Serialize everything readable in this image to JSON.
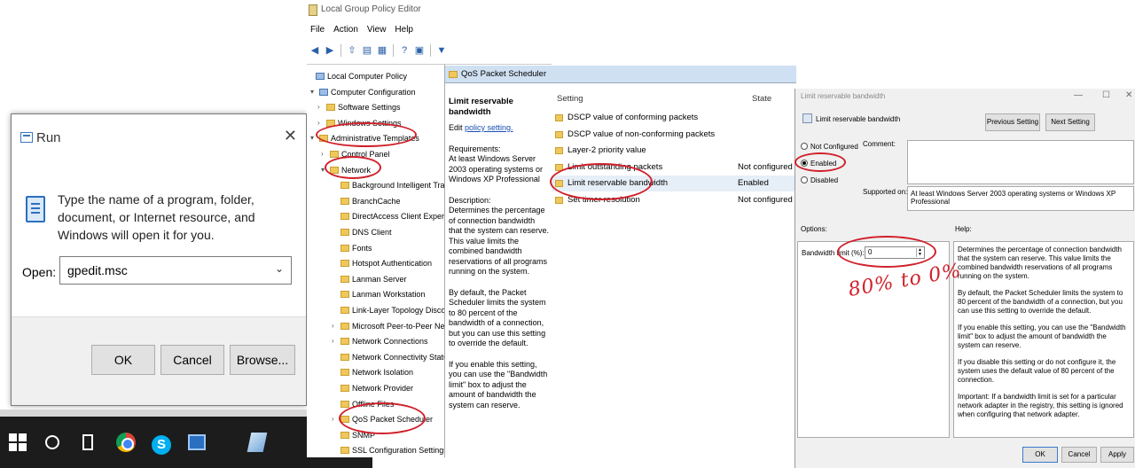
{
  "run_dialog": {
    "title": "Run",
    "close_glyph": "✕",
    "description": "Type the name of a program, folder, document, or Internet resource, and Windows will open it for you.",
    "open_label": "Open:",
    "open_value": "gpedit.msc",
    "ok_label": "OK",
    "cancel_label": "Cancel",
    "browse_label": "Browse..."
  },
  "taskbar": {
    "icons": [
      "windows-start-icon",
      "cortana-icon",
      "task-view-icon",
      "chrome-icon",
      "skype-icon",
      "run-icon",
      "sticky-notes-icon"
    ],
    "skype_glyph": "S"
  },
  "gpe": {
    "title": "Local Group Policy Editor",
    "menu": [
      "File",
      "Action",
      "View",
      "Help"
    ],
    "tree": [
      {
        "label": "Local Computer Policy",
        "arrow": ""
      },
      {
        "label": "Computer Configuration",
        "arrow": "▾"
      },
      {
        "label": "Software Settings",
        "arrow": "›"
      },
      {
        "label": "Windows Settings",
        "arrow": "›"
      },
      {
        "label": "Administrative Templates",
        "arrow": "▾"
      },
      {
        "label": "Control Panel",
        "arrow": "›"
      },
      {
        "label": "Network",
        "arrow": "▾"
      },
      {
        "label": "Background Intelligent Transfer",
        "arrow": ""
      },
      {
        "label": "BranchCache",
        "arrow": ""
      },
      {
        "label": "DirectAccess Client Experience S",
        "arrow": ""
      },
      {
        "label": "DNS Client",
        "arrow": ""
      },
      {
        "label": "Fonts",
        "arrow": ""
      },
      {
        "label": "Hotspot Authentication",
        "arrow": ""
      },
      {
        "label": "Lanman Server",
        "arrow": ""
      },
      {
        "label": "Lanman Workstation",
        "arrow": ""
      },
      {
        "label": "Link-Layer Topology Discovery",
        "arrow": ""
      },
      {
        "label": "Microsoft Peer-to-Peer Network",
        "arrow": "›"
      },
      {
        "label": "Network Connections",
        "arrow": "›"
      },
      {
        "label": "Network Connectivity Status Ind",
        "arrow": ""
      },
      {
        "label": "Network Isolation",
        "arrow": ""
      },
      {
        "label": "Network Provider",
        "arrow": ""
      },
      {
        "label": "Offline Files",
        "arrow": ""
      },
      {
        "label": "QoS Packet Scheduler",
        "arrow": "›"
      },
      {
        "label": "SNMP",
        "arrow": ""
      },
      {
        "label": "SSL Configuration Settings",
        "arrow": ""
      }
    ],
    "pane_header": "QoS Packet Scheduler",
    "desc_title": "Limit reservable bandwidth",
    "edit_prefix": "Edit",
    "edit_link": "policy setting.",
    "requirements": "Requirements:\nAt least Windows Server 2003 operating systems or Windows XP Professional",
    "description": "Description:\nDetermines the percentage of connection bandwidth that the system can reserve. This value limits the combined bandwidth reservations of all programs running on the system.",
    "default_text": "By default, the Packet Scheduler limits the system to 80 percent of the bandwidth of a connection, but you can use this setting to override the default.",
    "enable_text": "If you enable this setting, you can use the \"Bandwidth limit\" box to adjust the amount of bandwidth the system can reserve.",
    "col_setting": "Setting",
    "col_state": "State",
    "rows": [
      {
        "name": "DSCP value of conforming packets",
        "state": ""
      },
      {
        "name": "DSCP value of non-conforming packets",
        "state": ""
      },
      {
        "name": "Layer-2 priority value",
        "state": ""
      },
      {
        "name": "Limit outstanding packets",
        "state": "Not configured"
      },
      {
        "name": "Limit reservable bandwidth",
        "state": "Enabled"
      },
      {
        "name": "Set timer resolution",
        "state": "Not configured"
      }
    ]
  },
  "setting_dialog": {
    "title": "Limit reservable bandwidth",
    "window_controls": [
      "—",
      "☐",
      "✕"
    ],
    "subtitle": "Limit reservable bandwidth",
    "prev_label": "Previous Setting",
    "next_label": "Next Setting",
    "radio_not_configured": "Not Configured",
    "radio_enabled": "Enabled",
    "radio_disabled": "Disabled",
    "comment_label": "Comment:",
    "supported_label": "Supported on:",
    "supported_value": "At least Windows Server 2003 operating systems or Windows XP Professional",
    "options_label": "Options:",
    "help_label": "Help:",
    "bandwidth_label": "Bandwidth limit (%):",
    "bandwidth_value": "0",
    "help_paragraphs": [
      "Determines the percentage of connection bandwidth that the system can reserve. This value limits the combined bandwidth reservations of all programs running on the system.",
      "By default, the Packet Scheduler limits the system to 80 percent of the bandwidth of a connection, but you can use this setting to override the default.",
      "If you enable this setting, you can use the \"Bandwidth limit\" box to adjust the amount of bandwidth the system can reserve.",
      "If you disable this setting or do not configure it, the system uses the default value of 80 percent of the connection.",
      "Important: If a bandwidth limit is set for a particular network adapter in the registry, this setting is ignored when configuring that network adapter."
    ],
    "ok_label": "OK",
    "cancel_label": "Cancel",
    "apply_label": "Apply",
    "annotation": "80% to 0%"
  },
  "colors": {
    "annotation_red": "#d0202a",
    "taskbar_bg": "#1c1c1c",
    "header_blue": "#cfe0f2"
  }
}
